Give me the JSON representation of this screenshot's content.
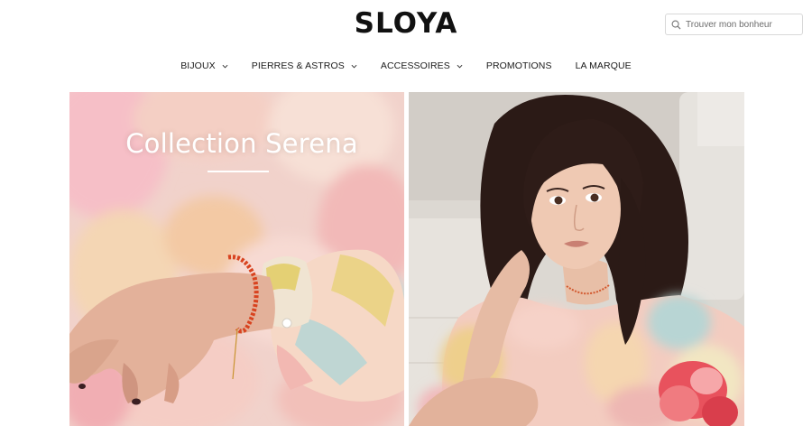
{
  "header": {
    "logo": "SLOYA",
    "search_placeholder": "Trouver mon bonheur"
  },
  "nav": {
    "items": [
      {
        "label": "BIJOUX",
        "has_dropdown": true
      },
      {
        "label": "PIERRES & ASTROS",
        "has_dropdown": true
      },
      {
        "label": "ACCESSOIRES",
        "has_dropdown": true
      },
      {
        "label": "PROMOTIONS",
        "has_dropdown": false
      },
      {
        "label": "LA MARQUE",
        "has_dropdown": false
      }
    ]
  },
  "hero": {
    "left_title": "Collection Serena"
  },
  "icons": {
    "search": "search-icon",
    "dropdown": "chevron-down-icon"
  },
  "colors": {
    "text": "#1a1a1a",
    "border": "#d8d8d8",
    "title": "#ffffff"
  }
}
